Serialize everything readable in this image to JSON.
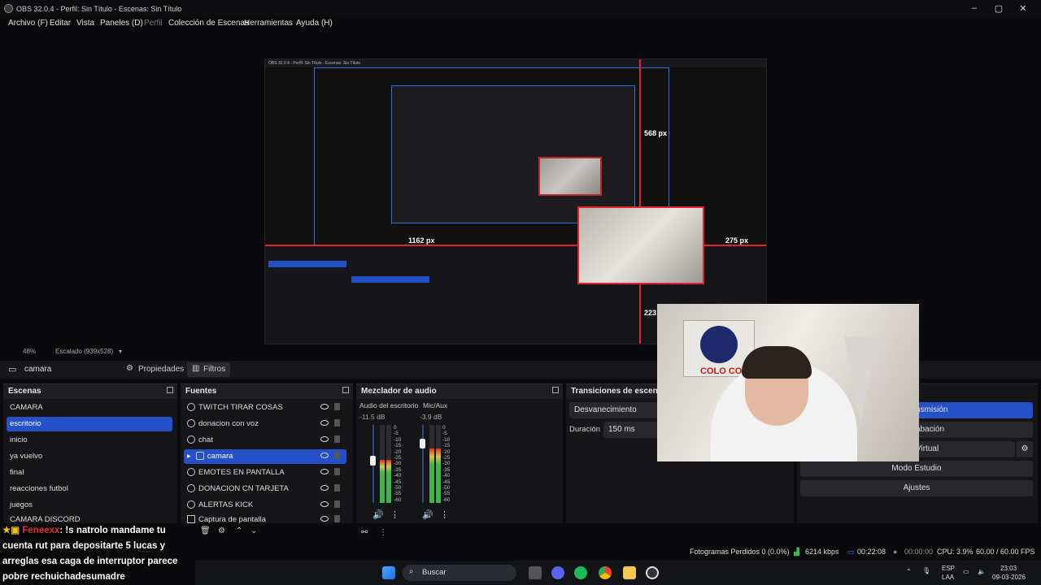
{
  "window": {
    "title": "OBS 32.0.4 - Perfil: Sin Título - Escenas: Sin Título"
  },
  "menu": [
    "Archivo (F)",
    "Editar",
    "Vista",
    "Paneles (D)",
    "Perfil",
    "Colección de Escenas",
    "Herramientas",
    "Ayuda (H)"
  ],
  "preview": {
    "inner_title": "OBS 32.0.4 - Perfil: Sin Título - Escenas: Sin Título",
    "labels": {
      "top": "568 px",
      "left": "1162 px",
      "right": "275 px",
      "bottom": "223"
    }
  },
  "status_mini": {
    "zoom": "48%",
    "scale": "Escalado (939x528)"
  },
  "source_bar": {
    "name": "camara",
    "properties": "Propiedades",
    "filters": "Filtros"
  },
  "scenes": {
    "header": "Escenas",
    "items": [
      "CAMARA",
      "escritorio",
      "inicio",
      "ya vuelvo",
      "final",
      "reacciones futbol",
      "juegos",
      "CAMARA DISCORD"
    ],
    "selected": "escritorio"
  },
  "sources": {
    "header": "Fuentes",
    "items": [
      "TWITCH TIRAR COSAS",
      "donacion con voz",
      "chat",
      "camara",
      "EMOTES EN PANTALLA",
      "DONACION CN TARJETA",
      "ALERTAS KICK",
      "Captura de pantalla"
    ],
    "selected": "camara"
  },
  "mixer": {
    "header": "Mezclador de audio",
    "channels": [
      {
        "name": "Audio del escritorio",
        "db": "-11.5 dB",
        "level": 0.55,
        "fader": 0.55
      },
      {
        "name": "Mic/Aux",
        "db": "-3.9 dB",
        "level": 0.7,
        "fader": 0.8
      }
    ],
    "scale": [
      "0",
      "-5",
      "-10",
      "-15",
      "-20",
      "-25",
      "-30",
      "-35",
      "-40",
      "-45",
      "-50",
      "-55",
      "-60"
    ]
  },
  "transitions": {
    "header": "Transiciones de escena",
    "type": "Desvanecimiento",
    "duration_label": "Duración",
    "duration": "150 ms"
  },
  "controls": {
    "stream": "nsmisión",
    "record": "abación",
    "virtual": "Virtual",
    "studio": "Modo Estudio",
    "settings": "Ajustes"
  },
  "chat": {
    "user": "Feneexx",
    "message": ": !s natrolo mandame tu cuenta rut para depositarte 5 lucas y arreglas esa caga de interruptor parece pobre rechuichadesumadre"
  },
  "stats": {
    "dropped": "Fotogramas Perdidos 0 (0.0%)",
    "bitrate": "6214 kbps",
    "stream_time": "00:22:08",
    "rec_time": "00:00:00",
    "cpu": "CPU: 3.9%",
    "fps": "60.00 / 60.00 FPS"
  },
  "taskbar": {
    "search": "Buscar",
    "lang": "ESP",
    "layout": "LAA",
    "time": "23:03",
    "date": "09-03-2026"
  },
  "colors": {
    "accent": "#2450c8",
    "record_red": "#e0242c",
    "meter_green": "#3fb54a"
  }
}
